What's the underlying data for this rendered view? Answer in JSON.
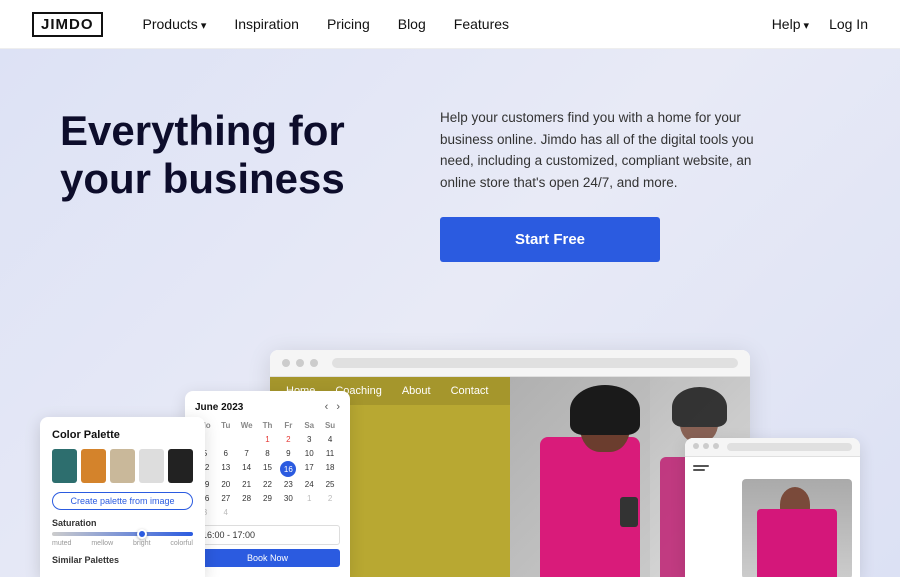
{
  "nav": {
    "logo": "JIMDO",
    "links": [
      {
        "label": "Products",
        "hasArrow": true
      },
      {
        "label": "Inspiration",
        "hasArrow": false
      },
      {
        "label": "Pricing",
        "hasArrow": false
      },
      {
        "label": "Blog",
        "hasArrow": false
      },
      {
        "label": "Features",
        "hasArrow": false
      }
    ],
    "help": "Help",
    "login": "Log In"
  },
  "hero": {
    "title": "Everything for your business",
    "description": "Help your customers find you with a home for your business online. Jimdo has all of the digital tools you need, including a customized, compliant website, an online store that's open 24/7, and more.",
    "cta_button": "Start Free"
  },
  "palette_card": {
    "title": "Color Palette",
    "create_btn": "Create palette from image",
    "saturation_label": "Saturation",
    "saturation_values": [
      "muted",
      "mellow",
      "bright",
      "colorful"
    ],
    "similar_label": "Similar Palettes"
  },
  "calendar_card": {
    "title": "June 2023",
    "day_headers": [
      "Mo",
      "Tu",
      "We",
      "Th",
      "Fr",
      "Sa",
      "Su"
    ],
    "weeks": [
      [
        "",
        "",
        "",
        "1",
        "2",
        "3",
        "4"
      ],
      [
        "5",
        "6",
        "7",
        "8",
        "9",
        "10",
        "11"
      ],
      [
        "12",
        "13",
        "14",
        "15",
        "16",
        "17",
        "18"
      ],
      [
        "19",
        "20",
        "21",
        "22",
        "23",
        "24",
        "25"
      ],
      [
        "26",
        "27",
        "28",
        "29",
        "30",
        "1",
        "2"
      ],
      [
        "3",
        "4",
        "",
        "",
        "",
        "",
        ""
      ]
    ],
    "today": "16",
    "time_value": "16:00 - 17:00",
    "book_btn": "Book Now"
  },
  "site_nav": {
    "items": [
      "Home",
      "Coaching",
      "About",
      "Contact"
    ]
  },
  "colors": {
    "accent_blue": "#2b5be0",
    "hero_bg": "#dde2f5",
    "nav_bg": "#fff"
  }
}
